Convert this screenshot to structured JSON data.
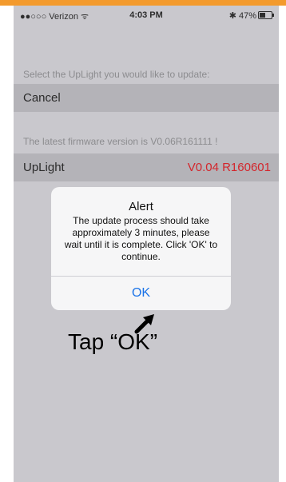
{
  "status_bar": {
    "carrier": "●●○○○ Verizon ᯤ",
    "time": "4:03 PM",
    "battery": "✱ 47%"
  },
  "update_screen": {
    "select_prompt": "Select the UpLight you would like to update:",
    "cancel_label": "Cancel",
    "firmware_note": "The latest firmware version is V0.06R161111 !",
    "device_name": "UpLight",
    "device_version": "V0.04 R160601"
  },
  "alert": {
    "title": "Alert",
    "message": "The update process should take approximately 3 minutes, please wait until it is complete. Click 'OK' to continue.",
    "ok_label": "OK"
  },
  "annotation": {
    "text": "Tap “OK”"
  },
  "colors": {
    "accent_bar": "#f39a2d",
    "version_text": "#d3262c",
    "ok_button": "#1a73e8"
  }
}
